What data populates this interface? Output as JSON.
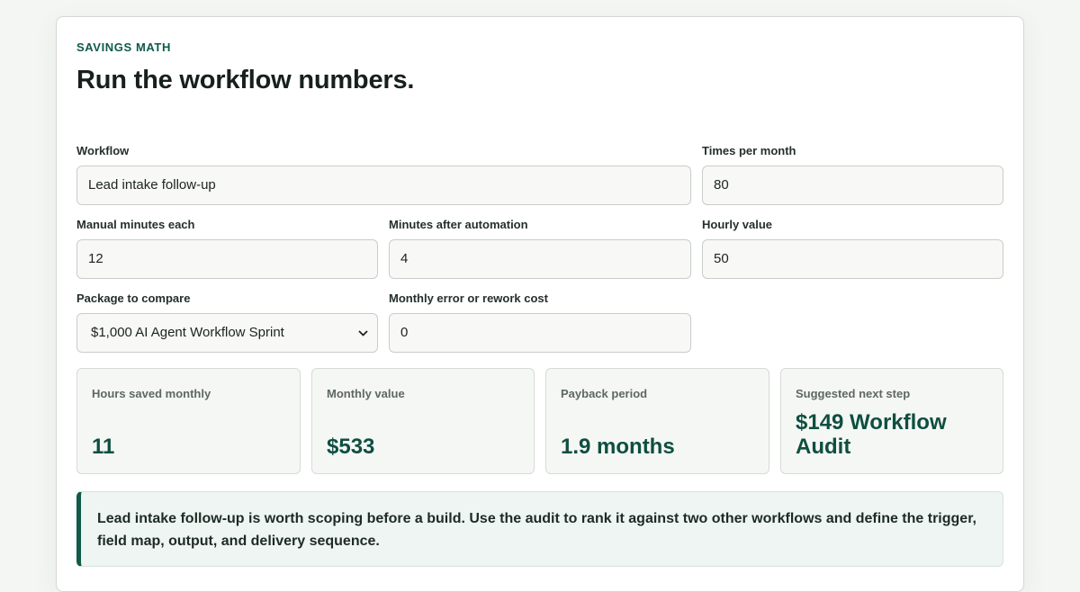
{
  "section": {
    "eyebrow": "SAVINGS MATH",
    "title": "Run the workflow numbers."
  },
  "form": {
    "workflow": {
      "label": "Workflow",
      "value": "Lead intake follow-up"
    },
    "times_per_month": {
      "label": "Times per month",
      "value": "80"
    },
    "manual_minutes": {
      "label": "Manual minutes each",
      "value": "12"
    },
    "minutes_after": {
      "label": "Minutes after automation",
      "value": "4"
    },
    "hourly_value": {
      "label": "Hourly value",
      "value": "50"
    },
    "package": {
      "label": "Package to compare",
      "value": "$1,000 AI Agent Workflow Sprint"
    },
    "error_cost": {
      "label": "Monthly error or rework cost",
      "value": "0"
    }
  },
  "results": [
    {
      "label": "Hours saved monthly",
      "value": "11"
    },
    {
      "label": "Monthly value",
      "value": "$533"
    },
    {
      "label": "Payback period",
      "value": "1.9 months"
    },
    {
      "label": "Suggested next step",
      "value": "$149 Workflow Audit"
    }
  ],
  "note": "Lead intake follow-up is worth scoping before a build. Use the audit to rank it against two other workflows and define the trigger, field map, output, and delivery sequence.",
  "colors": {
    "accent": "#0f5a4a",
    "background": "#f4f6f3",
    "card": "#ffffff"
  },
  "icons": {
    "select_arrow": "chevron-down-icon"
  }
}
